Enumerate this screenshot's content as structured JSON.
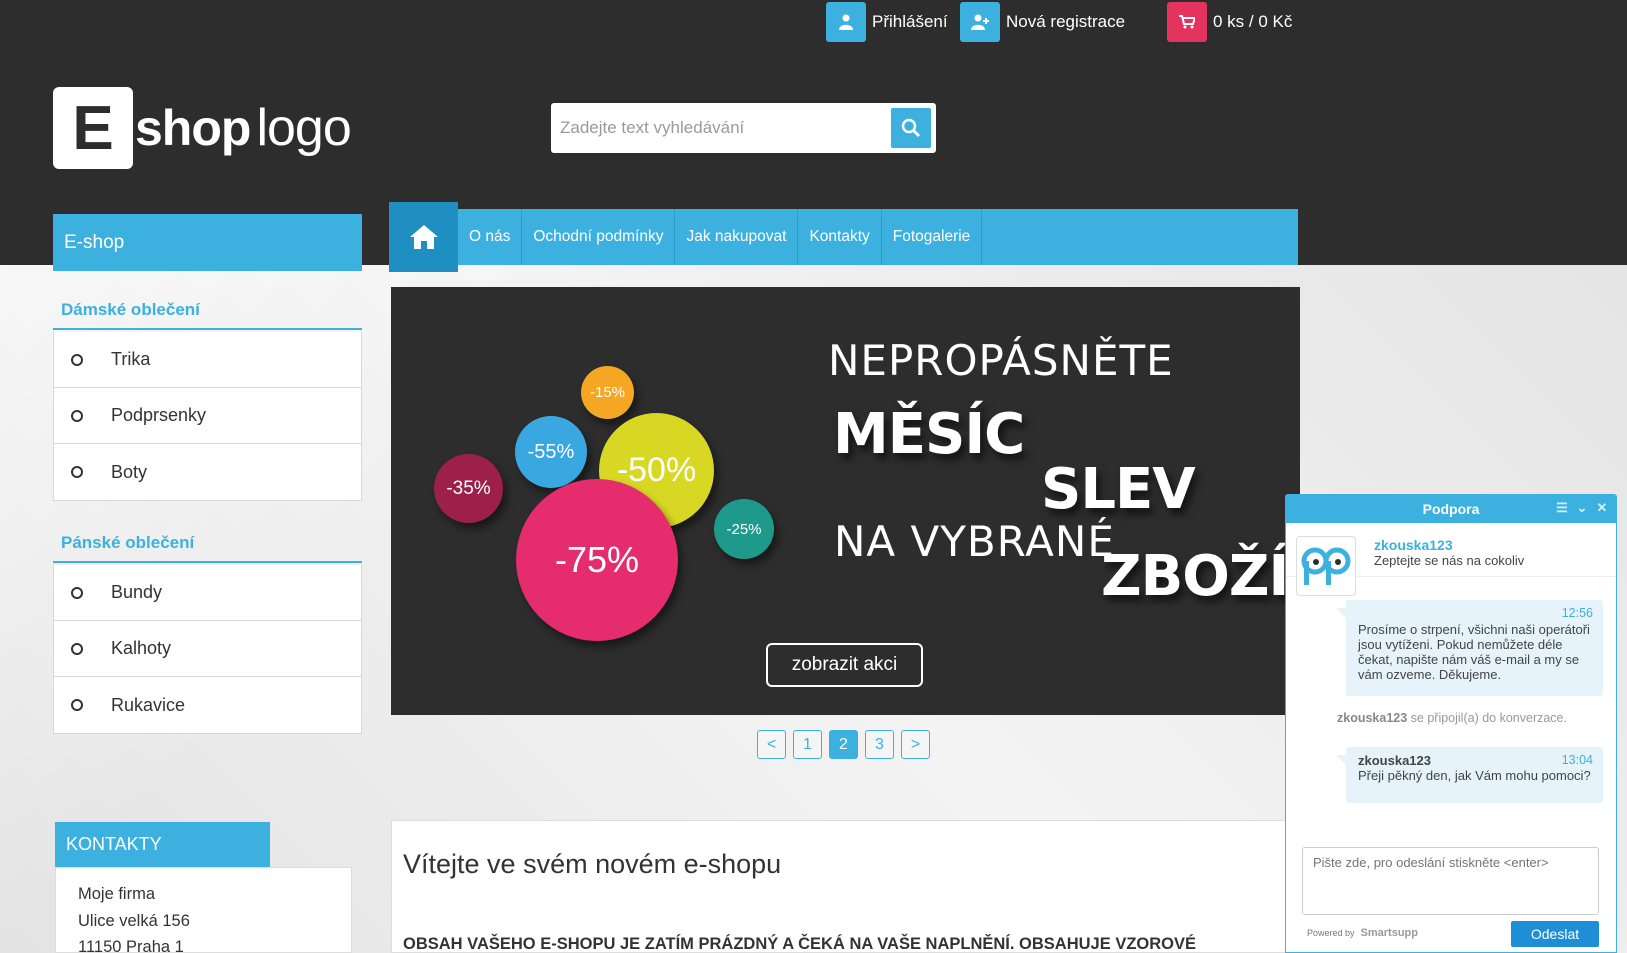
{
  "topbar": {
    "login_label": "Přihlášení",
    "register_label": "Nová registrace",
    "cart_label": "0 ks / 0 Kč"
  },
  "logo": {
    "letter": "E",
    "part1": "shop",
    "part2": "logo"
  },
  "search": {
    "placeholder": "Zadejte text vyhledávání"
  },
  "sidebar": {
    "title": "E-shop",
    "categories": [
      {
        "title": "Dámské oblečení",
        "items": [
          "Trika",
          "Podprsenky",
          "Boty"
        ]
      },
      {
        "title": "Pánské oblečení",
        "items": [
          "Bundy",
          "Kalhoty",
          "Rukavice"
        ]
      }
    ]
  },
  "nav": {
    "items": [
      "O nás",
      "Ochodní podmínky",
      "Jak nakupovat",
      "Kontakty",
      "Fotogalerie"
    ]
  },
  "banner": {
    "line1": "NEPROPÁSNĚTE",
    "line2": "MĚSÍC",
    "line3": "SLEV",
    "line4": "NA VYBRANÉ",
    "line5": "ZBOŽÍ",
    "cta": "zobrazit akci",
    "bubbles": [
      "-15%",
      "-55%",
      "-50%",
      "-35%",
      "-25%",
      "-75%"
    ]
  },
  "pager": {
    "prev": "<",
    "pages": [
      "1",
      "2",
      "3"
    ],
    "active": "2",
    "next": ">"
  },
  "kontakty": {
    "title": "KONTAKTY",
    "lines": [
      "Moje firma",
      "Ulice velká 156",
      "11150 Praha 1"
    ]
  },
  "main": {
    "title": "Vítejte ve svém novém e-shopu",
    "text": "OBSAH VAŠEHO E-SHOPU JE ZATÍM PRÁZDNÝ A ČEKÁ NA VAŠE NAPLNĚNÍ. OBSAHUJE VZOROVÉ"
  },
  "chat": {
    "title": "Podpora",
    "agent_name": "zkouska123",
    "agent_sub": "Zeptejte se nás na cokoliv",
    "msg1": {
      "time": "12:56",
      "text": "Prosíme o strpení, všichni naši operátoři jsou vytíženi. Pokud nemůžete déle čekat, napište nám váš e-mail a my se vám ozveme. Děkujeme."
    },
    "system_name": "zkouska123",
    "system_text": " se připojil(a) do konverzace.",
    "msg2": {
      "author": "zkouska123",
      "time": "13:04",
      "text": "Přeji pěkný den, jak Vám mohu pomoci?"
    },
    "input_placeholder": "Pište zde, pro odeslání stiskněte <enter>",
    "powered": "Powered by",
    "brand": "Smartsupp",
    "send_label": "Odeslat"
  },
  "colors": {
    "accent": "#3cb1e0",
    "dark": "#2d2d2d",
    "cart": "#e4335e",
    "bubble_orange": "#f5a623",
    "bubble_blue": "#3aa8e0",
    "bubble_yellow": "#d8d824",
    "bubble_maroon": "#9c2049",
    "bubble_teal": "#1e9a8d",
    "bubble_pink": "#e52d6e"
  }
}
